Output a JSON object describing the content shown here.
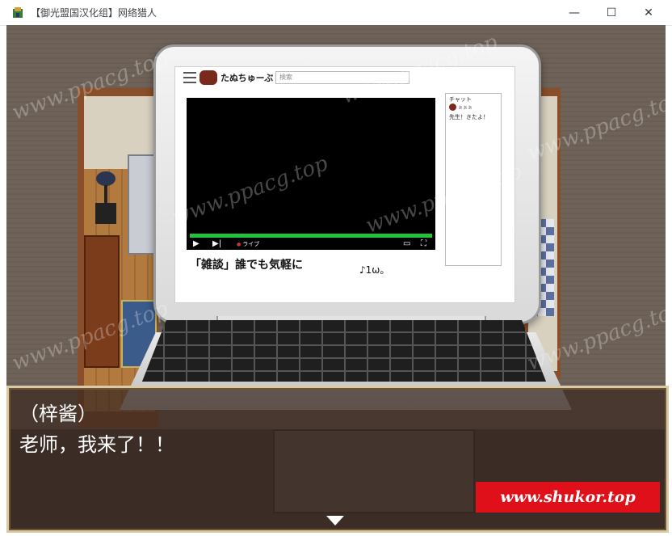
{
  "window": {
    "title": "【御光盟国汉化组】网络猎人",
    "minimize_glyph": "—",
    "maximize_glyph": "☐",
    "close_glyph": "✕"
  },
  "laptop": {
    "site_name": "たぬちゅーぶ",
    "search_placeholder": "検索",
    "video": {
      "title": "「雑談」誰でも気軽に",
      "handwriting": "♪1ω。",
      "live_label": "ライブ",
      "play_icon": "▶",
      "next_icon": "▶|",
      "screen_icon": "▭",
      "fullscreen_icon": "⛶",
      "progress": 1.0
    },
    "chat": {
      "title": "チャット",
      "user": "ぁぁぁ",
      "message": "先生！きたよ！"
    }
  },
  "dialogue": {
    "speaker": "（梓酱）",
    "text": "老师，我来了！！",
    "continue_icon": "triangle-down"
  },
  "promo": {
    "text": "www.shukor.top"
  },
  "watermark": {
    "text": "www.ppacg.top"
  }
}
